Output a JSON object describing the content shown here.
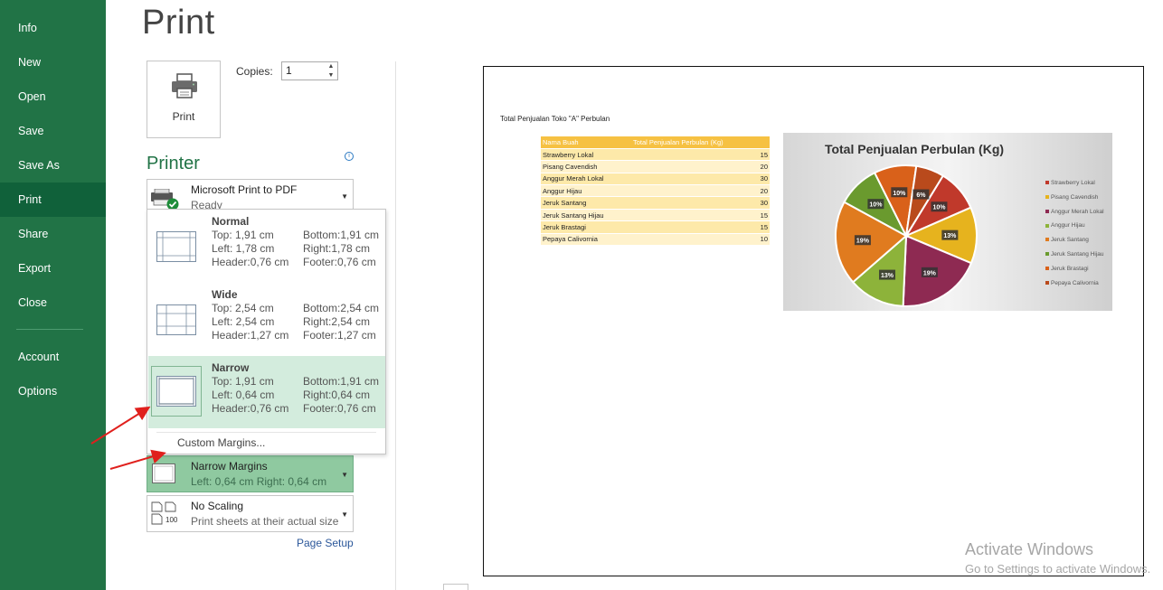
{
  "nav": {
    "items": [
      {
        "label": "Info"
      },
      {
        "label": "New"
      },
      {
        "label": "Open"
      },
      {
        "label": "Save"
      },
      {
        "label": "Save As"
      },
      {
        "label": "Print"
      },
      {
        "label": "Share"
      },
      {
        "label": "Export"
      },
      {
        "label": "Close"
      },
      {
        "label": "Account"
      },
      {
        "label": "Options"
      }
    ],
    "active": "Print"
  },
  "page": {
    "title": "Print"
  },
  "print_button": {
    "label": "Print",
    "icon": "printer-icon"
  },
  "copies": {
    "label": "Copies:",
    "value": "1"
  },
  "printer": {
    "heading": "Printer",
    "name": "Microsoft Print to PDF",
    "status": "Ready"
  },
  "margins_dropdown": {
    "options": [
      {
        "name": "Normal",
        "top": "Top:  1,91 cm",
        "bottom": "Bottom:1,91 cm",
        "left": "Left:  1,78 cm",
        "right": "Right:1,78 cm",
        "header": "Header:0,76 cm",
        "footer": "Footer:0,76 cm"
      },
      {
        "name": "Wide",
        "top": "Top:  2,54 cm",
        "bottom": "Bottom:2,54 cm",
        "left": "Left:  2,54 cm",
        "right": "Right:2,54 cm",
        "header": "Header:1,27 cm",
        "footer": "Footer:1,27 cm"
      },
      {
        "name": "Narrow",
        "top": "Top:  1,91 cm",
        "bottom": "Bottom:1,91 cm",
        "left": "Left:  0,64 cm",
        "right": "Right:0,64 cm",
        "header": "Header:0,76 cm",
        "footer": "Footer:0,76 cm"
      }
    ],
    "selected": "Narrow",
    "custom_label": "Custom Margins..."
  },
  "margins_setting": {
    "main": "Narrow Margins",
    "sub": "Left:  0,64 cm    Right:  0,64 cm"
  },
  "scaling_setting": {
    "main": "No Scaling",
    "sub": "Print sheets at their actual size",
    "icon_text": "100"
  },
  "page_setup_link": "Page Setup",
  "preview": {
    "sheet_title": "Total Penjualan Toko \"A\" Perbulan",
    "table": {
      "headers": [
        "Nama Buah",
        "Total Penjualan Perbulan (Kg)"
      ],
      "rows": [
        [
          "Strawberry Lokal",
          "15"
        ],
        [
          "Pisang Cavendish",
          "20"
        ],
        [
          "Anggur Merah Lokal",
          "30"
        ],
        [
          "Anggur Hijau",
          "20"
        ],
        [
          "Jeruk Santang",
          "30"
        ],
        [
          "Jeruk Santang Hijau",
          "15"
        ],
        [
          "Jeruk Brastagi",
          "15"
        ],
        [
          "Pepaya Calivornia",
          "10"
        ]
      ]
    }
  },
  "chart_data": {
    "type": "pie",
    "title": "Total Penjualan Perbulan (Kg)",
    "categories": [
      "Strawberry Lokal",
      "Pisang Cavendish",
      "Anggur Merah Lokal",
      "Anggur Hijau",
      "Jeruk Santang",
      "Jeruk Santang Hijau",
      "Jeruk Brastagi",
      "Pepaya Calivornia"
    ],
    "values": [
      15,
      20,
      30,
      20,
      30,
      15,
      15,
      10
    ],
    "data_labels": [
      "10%",
      "13%",
      "19%",
      "13%",
      "19%",
      "10%",
      "10%",
      "6%"
    ],
    "legend_position": "right",
    "colors": [
      "#c0392b",
      "#e6b31e",
      "#8e2a52",
      "#8db33a",
      "#e07b1f",
      "#6a9a2e",
      "#d9611a",
      "#b94a1c"
    ]
  },
  "watermark": {
    "line1": "Activate Windows",
    "line2": "Go to Settings to activate Windows."
  },
  "theme": {
    "accent": "#217346",
    "selected_option": "#d3ecdd",
    "table_header": "#f6c142"
  }
}
